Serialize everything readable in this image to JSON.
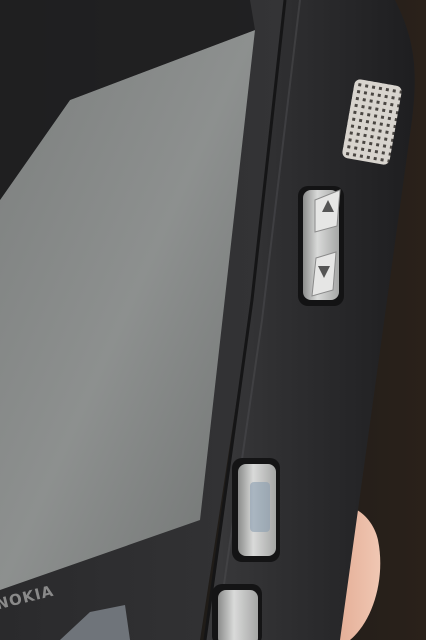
{
  "photo": {
    "subject": "phone-side-profile",
    "brand_text": "NOKIA",
    "colors": {
      "background": "#1a1714",
      "body": "#2b2b2d",
      "screen": "#8f9291",
      "button_metal": "#c8c9c8",
      "skin": "#e0a990"
    },
    "icons": [
      "speaker-grille-icon",
      "volume-up-arrow-icon",
      "volume-down-arrow-icon"
    ]
  }
}
